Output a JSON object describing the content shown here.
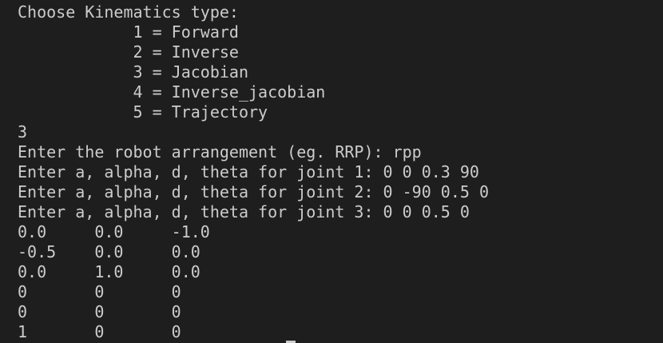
{
  "terminal": {
    "lines": [
      "Choose Kinematics type:",
      "            1 = Forward",
      "            2 = Inverse",
      "            3 = Jacobian",
      "            4 = Inverse_jacobian",
      "            5 = Trajectory",
      "3",
      "Enter the robot arrangement (eg. RRP): rpp",
      "Enter a, alpha, d, theta for joint 1: 0 0 0.3 90",
      "Enter a, alpha, d, theta for joint 2: 0 -90 0.5 0",
      "Enter a, alpha, d, theta for joint 3: 0 0 0.5 0",
      "0.0     0.0     -1.0",
      "-0.5    0.0     0.0",
      "0.0     1.0     0.0",
      "0       0       0",
      "0       0       0",
      "1       0       0"
    ]
  }
}
